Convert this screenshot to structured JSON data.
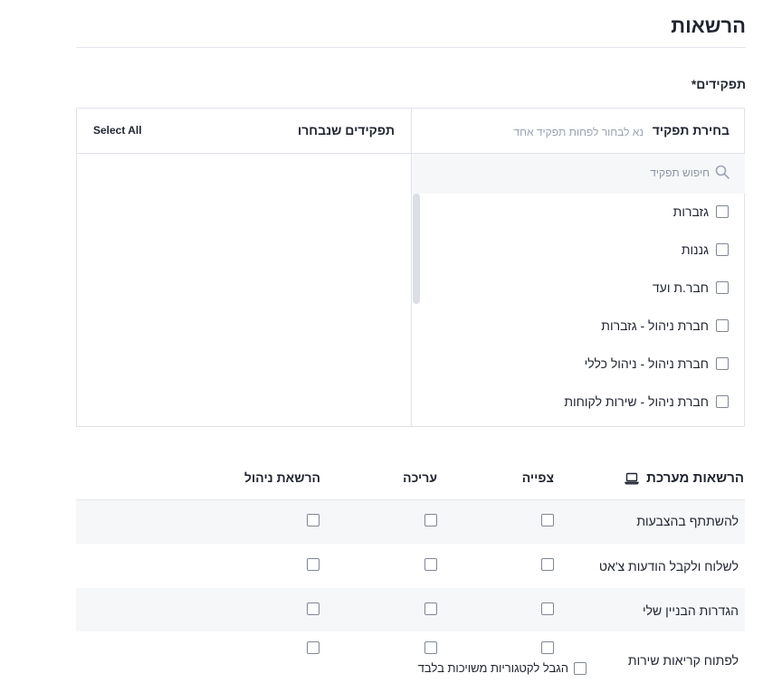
{
  "section": {
    "title": "הרשאות"
  },
  "roles": {
    "label": "תפקידים*",
    "picker": {
      "choose_title": "בחירת תפקיד",
      "choose_hint": "נא לבחור לפחות תפקיד אחד",
      "selected_title": "תפקידים שנבחרו",
      "select_all": "Select All",
      "search_placeholder": "חיפוש תפקיד",
      "items": [
        {
          "label": "גזברות",
          "checked": false
        },
        {
          "label": "גננות",
          "checked": false
        },
        {
          "label": "חבר.ת ועד",
          "checked": false
        },
        {
          "label": "חברת ניהול - גזברות",
          "checked": false
        },
        {
          "label": "חברת ניהול - ניהול כללי",
          "checked": false
        },
        {
          "label": "חברת ניהול - שירות לקוחות",
          "checked": false
        }
      ],
      "selected_items": []
    }
  },
  "permissions": {
    "header": {
      "title": "הרשאות מערכת",
      "icon": "laptop-icon",
      "view": "צפייה",
      "edit": "עריכה",
      "manage": "הרשאת ניהול"
    },
    "rows": [
      {
        "label": "להשתתף בהצבעות",
        "view": false,
        "edit": false,
        "manage": false
      },
      {
        "label": "לשלוח ולקבל הודעות צ'אט",
        "view": false,
        "edit": false,
        "manage": false
      },
      {
        "label": "הגדרות הבניין שלי",
        "view": false,
        "edit": false,
        "manage": false
      },
      {
        "label": "לפתוח קריאות שירות",
        "view": false,
        "edit": false,
        "manage": false
      }
    ],
    "service_calls_option": {
      "label": "הגבל לקטגוריות משויכות בלבד",
      "checked": false
    }
  }
}
